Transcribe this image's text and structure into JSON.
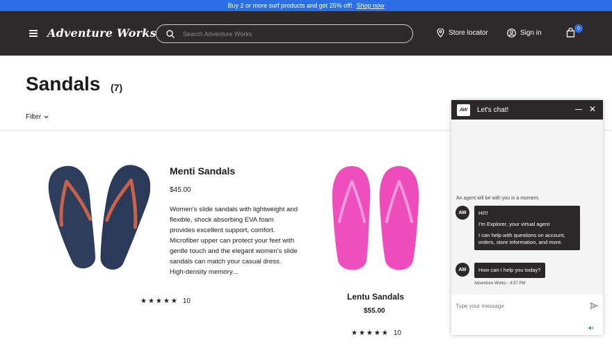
{
  "promo": {
    "text": "Buy 2 or more surf products and get 25% off!",
    "link": "Shop now"
  },
  "header": {
    "brand": "Adventure Works",
    "search_placeholder": "Search Adventure Works",
    "store_locator": "Store locator",
    "sign_in": "Sign in",
    "cart_count": "0"
  },
  "page": {
    "title": "Sandals",
    "count": "(7)",
    "filter_label": "Filter"
  },
  "products": [
    {
      "name": "Menti Sandals",
      "price": "$45.00",
      "description": "Women's slide sandals with lightweight and flexible, shock absorbing EVA foam provides excellent support, comfort. Microfiber upper can protect your feet with gentle touch and the elegant women's slide sandals can match your casual dress. High-density memory...",
      "stars": "★★★★★",
      "reviews": "10",
      "color": "#2d3d5c",
      "strap_color": "#c8624a"
    },
    {
      "name": "Lentu Sandals",
      "price": "$55.00",
      "stars": "★★★★★",
      "reviews": "10",
      "color": "#ef4fbd",
      "strap_color": "#f47bd0"
    }
  ],
  "chat": {
    "logo": "AW",
    "title": "Let's chat!",
    "agent_note": "An agent will be with you in a moment.",
    "avatar": "AW",
    "messages": [
      "Hi!!!",
      "I'm Explorer, your virtual agent",
      "I can help with questions on account, orders, store information, and more."
    ],
    "question": "How can I help you today?",
    "timestamp": "Adventure Works - 4:57 PM",
    "input_placeholder": "Type your message"
  },
  "colors": {
    "promo": "#2b6fe6",
    "header": "#2e2a2b",
    "chat_header": "#2b2829"
  }
}
